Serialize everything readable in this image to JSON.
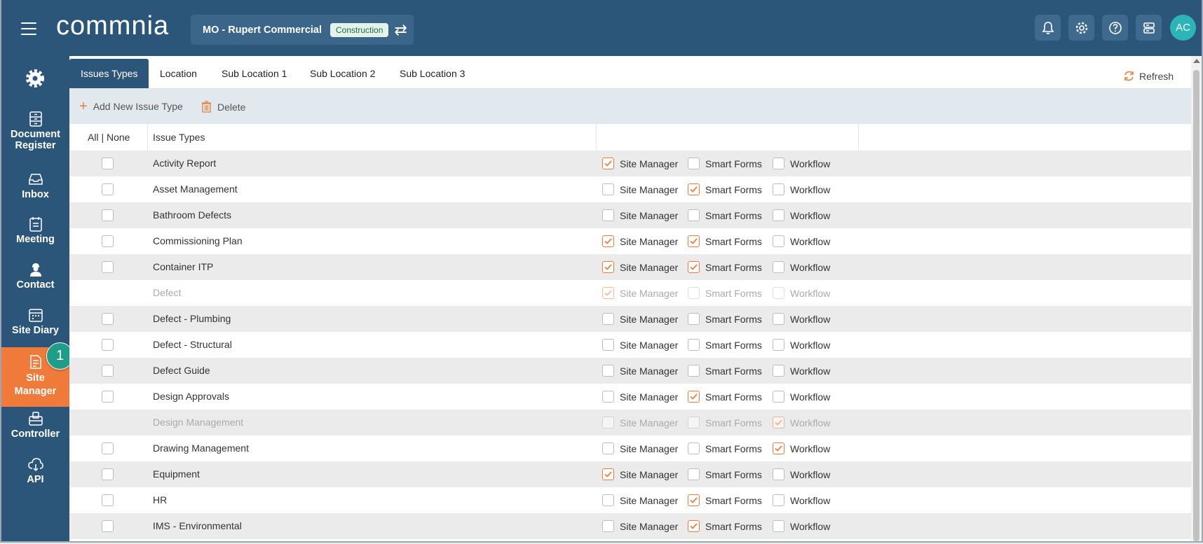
{
  "header": {
    "logo": "commnia",
    "project_name": "MO - Rupert Commercial",
    "project_badge": "Construction",
    "avatar_initials": "AC",
    "icons": [
      "bell-icon",
      "gear-icon",
      "help-icon",
      "server-icon"
    ]
  },
  "sidebar": {
    "items": [
      {
        "label": "Document Register",
        "icon": "document-register-icon"
      },
      {
        "label": "Inbox",
        "icon": "inbox-icon"
      },
      {
        "label": "Meeting",
        "icon": "meeting-icon"
      },
      {
        "label": "Contact",
        "icon": "contact-icon"
      },
      {
        "label": "Site Diary",
        "icon": "site-diary-icon"
      },
      {
        "label": "Site Manager",
        "icon": "site-manager-icon",
        "active": true
      },
      {
        "label": "Controller",
        "icon": "controller-icon"
      },
      {
        "label": "API",
        "icon": "api-icon"
      }
    ],
    "step_badge": "1"
  },
  "tabs": [
    "Issues Types",
    "Location",
    "Sub Location 1",
    "Sub Location 2",
    "Sub Location 3"
  ],
  "refresh_label": "Refresh",
  "toolbar": {
    "add_label": "Add New Issue Type",
    "delete_label": "Delete"
  },
  "table": {
    "col_all_none": "All | None",
    "col_issue_types": "Issue Types",
    "option_labels": [
      "Site Manager",
      "Smart Forms",
      "Workflow"
    ],
    "rows": [
      {
        "name": "Activity Report",
        "sm": true,
        "sf": false,
        "wf": false,
        "disabled": false
      },
      {
        "name": "Asset Management",
        "sm": false,
        "sf": true,
        "wf": false,
        "disabled": false
      },
      {
        "name": "Bathroom Defects",
        "sm": false,
        "sf": false,
        "wf": false,
        "disabled": false
      },
      {
        "name": "Commissioning Plan",
        "sm": true,
        "sf": true,
        "wf": false,
        "disabled": false
      },
      {
        "name": "Container ITP",
        "sm": true,
        "sf": true,
        "wf": false,
        "disabled": false
      },
      {
        "name": "Defect",
        "sm": true,
        "sf": false,
        "wf": false,
        "disabled": true
      },
      {
        "name": "Defect - Plumbing",
        "sm": false,
        "sf": false,
        "wf": false,
        "disabled": false
      },
      {
        "name": "Defect - Structural",
        "sm": false,
        "sf": false,
        "wf": false,
        "disabled": false
      },
      {
        "name": "Defect Guide",
        "sm": false,
        "sf": false,
        "wf": false,
        "disabled": false
      },
      {
        "name": "Design Approvals",
        "sm": false,
        "sf": true,
        "wf": false,
        "disabled": false
      },
      {
        "name": "Design Management",
        "sm": false,
        "sf": false,
        "wf": true,
        "disabled": true
      },
      {
        "name": "Drawing Management",
        "sm": false,
        "sf": false,
        "wf": true,
        "disabled": false
      },
      {
        "name": "Equipment",
        "sm": true,
        "sf": false,
        "wf": false,
        "disabled": false
      },
      {
        "name": "HR",
        "sm": false,
        "sf": true,
        "wf": false,
        "disabled": false
      },
      {
        "name": "IMS - Environmental",
        "sm": false,
        "sf": true,
        "wf": false,
        "disabled": false
      }
    ]
  },
  "colors": {
    "primary": "#2c5679",
    "accent": "#f07a3a",
    "badge_teal": "#1e9e88",
    "avatar": "#2bb5b8"
  }
}
